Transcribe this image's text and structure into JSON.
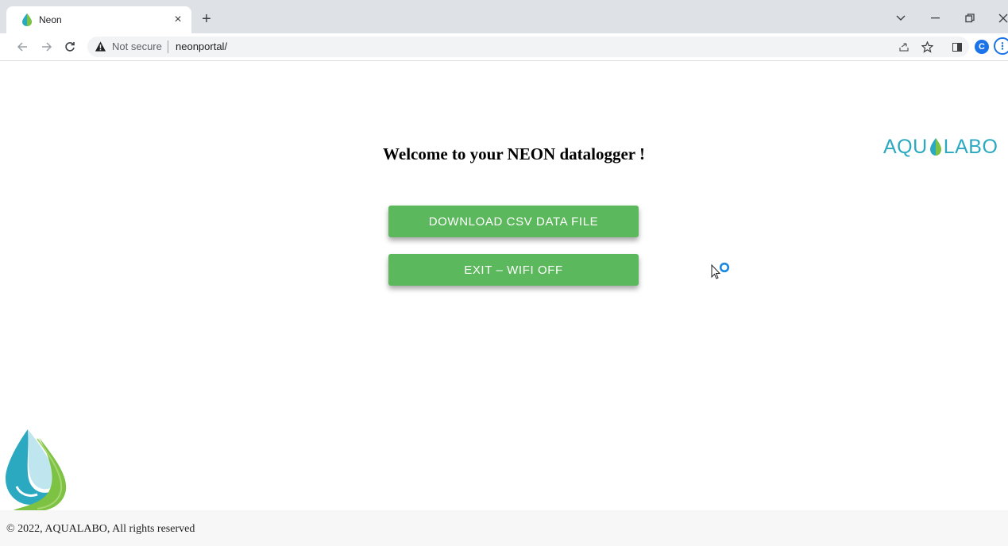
{
  "browser": {
    "tab": {
      "title": "Neon",
      "favicon": "water-drop-icon"
    },
    "address_bar": {
      "security_label": "Not secure",
      "url": "neonportal/"
    },
    "profile_initial": "C",
    "icons": {
      "back": "arrow-left-icon",
      "forward": "arrow-right-icon",
      "reload": "reload-icon",
      "share": "share-icon",
      "bookmark": "star-icon",
      "side_panel": "side-panel-icon",
      "menu": "kebab-menu-icon"
    }
  },
  "page": {
    "welcome_text": "Welcome to your NEON datalogger !",
    "brand": {
      "prefix": "AQU",
      "suffix": "LABO"
    },
    "buttons": {
      "download_label": "DOWNLOAD CSV DATA FILE",
      "exit_label": "EXIT – WIFI OFF"
    },
    "footer_text": "© 2022, AQUALABO, All rights reserved"
  },
  "colors": {
    "button_green": "#5cb85c",
    "brand_teal": "#2aa9c1",
    "drop_green": "#7dc242"
  }
}
